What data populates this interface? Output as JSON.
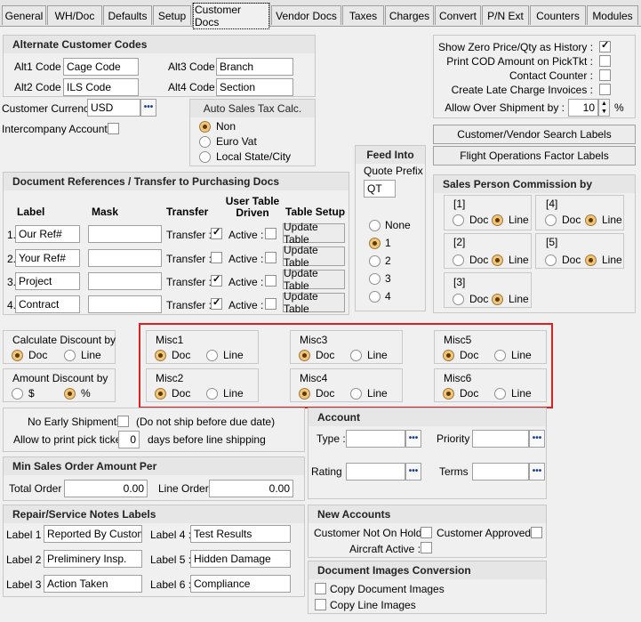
{
  "tabs": [
    "General",
    "WH/Doc",
    "Defaults",
    "Setup",
    "Customer Docs",
    "Vendor Docs",
    "Taxes",
    "Charges",
    "Convert",
    "P/N Ext",
    "Counters",
    "Modules"
  ],
  "alt_codes": {
    "title": "Alternate Customer Codes",
    "alt1_label": "Alt1 Code :",
    "alt1_value": "Cage Code",
    "alt2_label": "Alt2 Code :",
    "alt2_value": "ILS Code",
    "alt3_label": "Alt3 Code :",
    "alt3_value": "Branch",
    "alt4_label": "Alt4 Code :",
    "alt4_value": "Section"
  },
  "currency": {
    "label": "Customer Currency :",
    "value": "USD"
  },
  "intercompany": {
    "label": "Intercompany Account :"
  },
  "auto_tax": {
    "title": "Auto Sales Tax Calc.",
    "options": [
      "Non",
      "Euro Vat",
      "Local State/City"
    ],
    "selected": 0
  },
  "feed_into": {
    "title": "Feed Into",
    "quote_prefix_label": "Quote Prefix",
    "quote_prefix_value": "QT",
    "options": [
      "None",
      "1",
      "2",
      "3",
      "4"
    ],
    "selected": 1
  },
  "right_options": {
    "show_zero": "Show Zero Price/Qty as History :",
    "print_cod": "Print COD Amount on PickTkt :",
    "contact_counter": "Contact Counter :",
    "late_charge": "Create Late Charge Invoices :",
    "over_ship_label": "Allow Over Shipment by :",
    "over_ship_value": "10",
    "over_ship_unit": "%"
  },
  "buttons": {
    "search_labels": "Customer/Vendor Search Labels",
    "flight_labels": "Flight Operations Factor Labels"
  },
  "doc_refs": {
    "title": "Document References / Transfer to Purchasing Docs",
    "col_label": "Label",
    "col_mask": "Mask",
    "col_transfer": "Transfer",
    "col_user_table": "User Table Driven",
    "col_table_setup": "Table Setup",
    "transfer_label": "Transfer :",
    "active_label": "Active :",
    "update_label": "Update Table",
    "rows": [
      {
        "num": "1.",
        "label": "Our Ref#",
        "transfer": true
      },
      {
        "num": "2.",
        "label": "Your Ref#",
        "transfer": false
      },
      {
        "num": "3.",
        "label": "Project",
        "transfer": true
      },
      {
        "num": "4.",
        "label": "Contract",
        "transfer": true
      }
    ]
  },
  "commission": {
    "title": "Sales Person Commission by",
    "doc": "Doc",
    "line": "Line",
    "groups": [
      {
        "name": "[1]",
        "selected": "line"
      },
      {
        "name": "[4]",
        "selected": "line"
      },
      {
        "name": "[2]",
        "selected": "line"
      },
      {
        "name": "[5]",
        "selected": "line"
      },
      {
        "name": "[3]",
        "selected": "line"
      }
    ]
  },
  "discount": {
    "calc_title": "Calculate Discount by",
    "doc": "Doc",
    "line": "Line",
    "amount_title": "Amount Discount by",
    "dollar": "$",
    "percent": "%"
  },
  "misc": [
    {
      "name": "Misc1",
      "selected": "doc"
    },
    {
      "name": "Misc2",
      "selected": "doc"
    },
    {
      "name": "Misc3",
      "selected": "doc"
    },
    {
      "name": "Misc4",
      "selected": "doc"
    },
    {
      "name": "Misc5",
      "selected": "doc"
    },
    {
      "name": "Misc6",
      "selected": "doc"
    }
  ],
  "shipping": {
    "no_early": "No Early Shipments",
    "no_early_note": "(Do not ship before due date)",
    "allow_print": "Allow to print pick ticket",
    "days_value": "0",
    "days_note": "days before line shipping"
  },
  "min_order": {
    "title": "Min Sales Order Amount Per",
    "total_label": "Total Order :",
    "total_value": "0.00",
    "line_label": "Line Order :",
    "line_value": "0.00"
  },
  "account": {
    "title": "Account",
    "type": "Type :",
    "priority": "Priority :",
    "rating": "Rating :",
    "terms": "Terms :"
  },
  "repair": {
    "title": "Repair/Service Notes Labels",
    "labels": [
      {
        "label": "Label 1 :",
        "value": "Reported By Customer"
      },
      {
        "label": "Label 2 :",
        "value": "Preliminery Insp."
      },
      {
        "label": "Label 3 :",
        "value": "Action Taken"
      },
      {
        "label": "Label  4 :",
        "value": "Test Results"
      },
      {
        "label": "Label  5 :",
        "value": "Hidden Damage"
      },
      {
        "label": "Label  6 :",
        "value": "Compliance"
      }
    ]
  },
  "new_accounts": {
    "title": "New Accounts",
    "on_hold": "Customer Not On Hold :",
    "approved": "Customer Approved :",
    "aircraft": "Aircraft Active :"
  },
  "doc_images": {
    "title": "Document Images Conversion",
    "copy_doc": "Copy Document Images",
    "copy_line": "Copy Line Images"
  }
}
